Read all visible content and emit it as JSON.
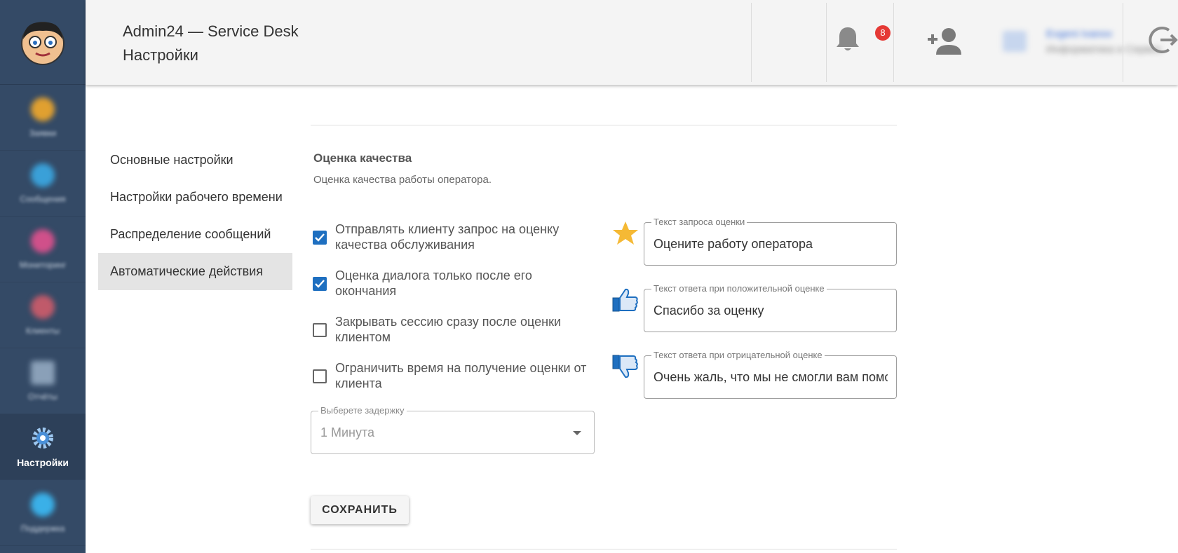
{
  "header": {
    "app_title": "Admin24 — Service Desk",
    "page_title": "Настройки",
    "notifications_count": "8",
    "user_name": "Evgeni Ivanov",
    "user_org": "Информатика и Сервис"
  },
  "rail": {
    "items": [
      {
        "label": "Заявки",
        "color": "#e0a030"
      },
      {
        "label": "Сообщения",
        "color": "#3aa0d8"
      },
      {
        "label": "Мониторинг",
        "color": "#d0508a"
      },
      {
        "label": "Клиенты",
        "color": "#c05a6a"
      },
      {
        "label": "Отчёты",
        "color": "#8aa0b8"
      },
      {
        "label": "Настройки",
        "color": "#ffffff"
      },
      {
        "label": "Поддержка",
        "color": "#3ab0e8"
      }
    ]
  },
  "nav": {
    "items": [
      {
        "label": "Основные настройки"
      },
      {
        "label": "Настройки рабочего времени"
      },
      {
        "label": "Распределение сообщений"
      },
      {
        "label": "Автоматические действия"
      }
    ],
    "active": "Автоматические действия"
  },
  "section": {
    "title": "Оценка качества",
    "subtitle": "Оценка качества работы оператора."
  },
  "options": [
    {
      "label": "Отправлять клиенту запрос на оценку качества обслуживания",
      "checked": true
    },
    {
      "label": "Оценка диалога только после его окончания",
      "checked": true
    },
    {
      "label": "Закрывать сессию сразу после оценки клиентом",
      "checked": false
    },
    {
      "label": "Ограничить время на получение оценки от клиента",
      "checked": false
    }
  ],
  "delay": {
    "label": "Выберете задержку",
    "value": "1 Минута"
  },
  "fields": {
    "request": {
      "label": "Текст запроса оценки",
      "value": "Оцените работу оператора"
    },
    "positive": {
      "label": "Текст ответа при положительной оценке",
      "value": "Спасибо за оценку"
    },
    "negative": {
      "label": "Текст ответа при отрицательной оценке",
      "value": "Очень жаль, что мы не смогли вам помочь"
    }
  },
  "save_label": "СОХРАНИТЬ",
  "colors": {
    "rail": "#344a66",
    "checkbox": "#1e6fc0",
    "badge": "#e53935",
    "thumb": "#1e6fc0",
    "star": "#f5b935"
  }
}
